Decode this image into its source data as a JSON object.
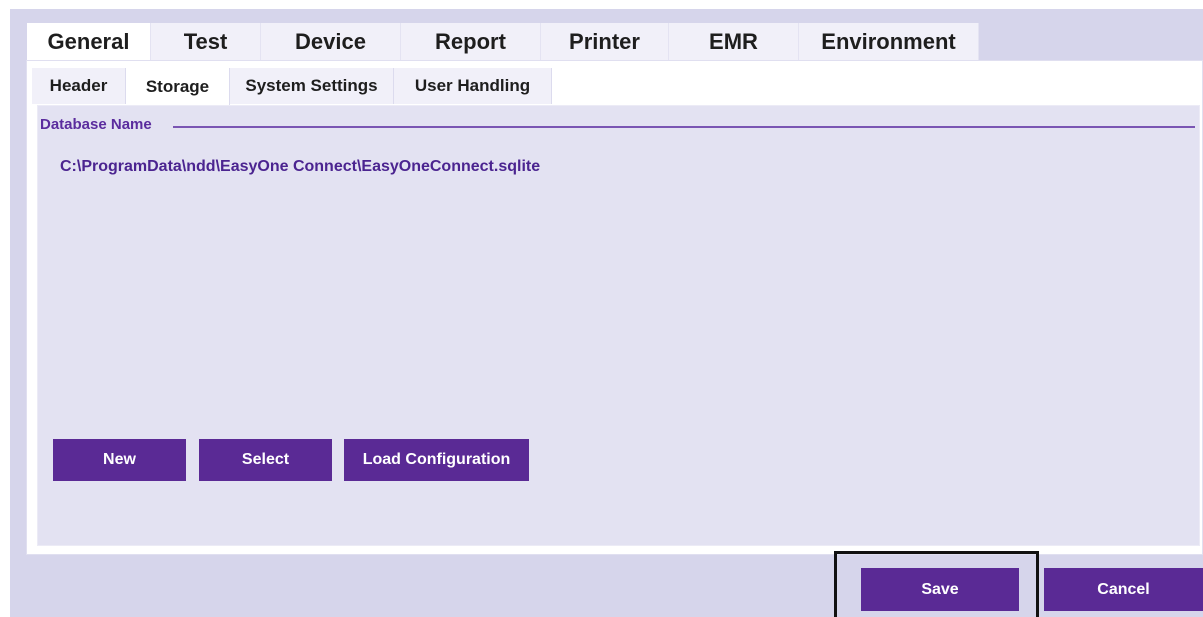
{
  "main_tabs": [
    {
      "label": "General",
      "active": true
    },
    {
      "label": "Test",
      "active": false
    },
    {
      "label": "Device",
      "active": false
    },
    {
      "label": "Report",
      "active": false
    },
    {
      "label": "Printer",
      "active": false
    },
    {
      "label": "EMR",
      "active": false
    },
    {
      "label": "Environment",
      "active": false
    }
  ],
  "sub_tabs": [
    {
      "label": "Header",
      "active": false
    },
    {
      "label": "Storage",
      "active": true
    },
    {
      "label": "System Settings",
      "active": false
    },
    {
      "label": "User Handling",
      "active": false
    }
  ],
  "storage": {
    "group_label": "Database Name",
    "database_path": "C:\\ProgramData\\ndd\\EasyOne Connect\\EasyOneConnect.sqlite",
    "new_label": "New",
    "select_label": "Select",
    "load_config_label": "Load Configuration"
  },
  "footer": {
    "save_label": "Save",
    "cancel_label": "Cancel"
  },
  "colors": {
    "accent": "#5a2a95",
    "panel_background": "#e3e2f2",
    "window_background": "#d6d5eb"
  }
}
